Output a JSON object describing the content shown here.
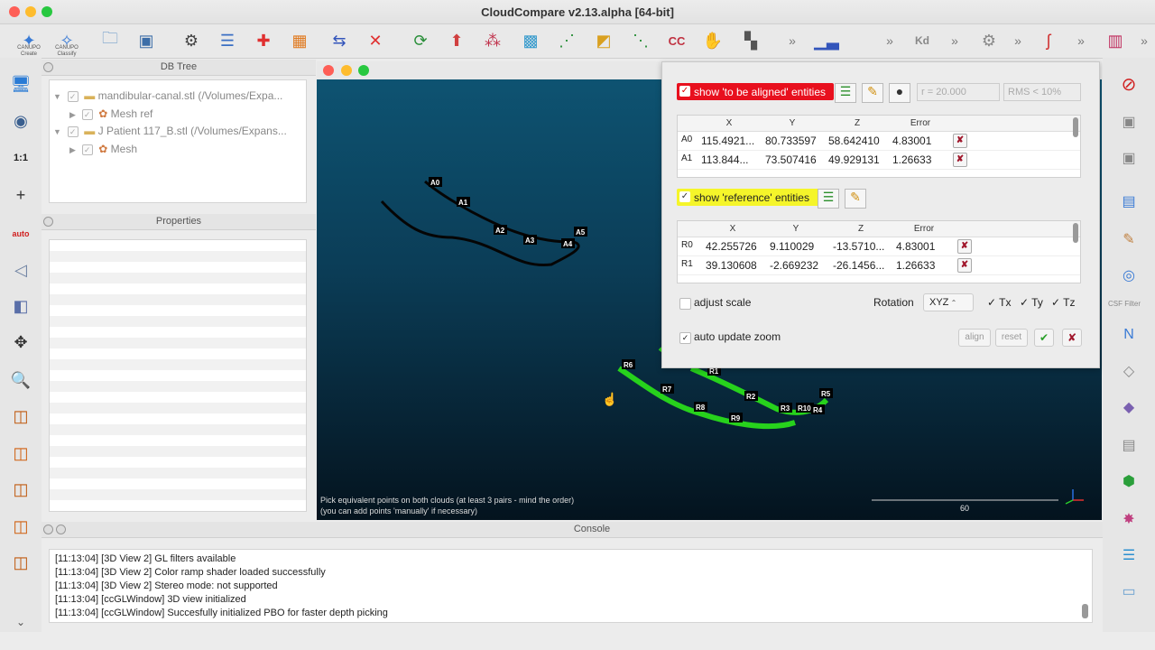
{
  "window": {
    "title": "CloudCompare v2.13.alpha [64-bit]"
  },
  "toolbar": {
    "canupo_create": "CANUPO\nCreate",
    "canupo_classify": "CANUPO\nClassify",
    "kd_label": "Kd"
  },
  "left_tools": {
    "scale_label": "1:1",
    "auto_label": "auto"
  },
  "db_tree": {
    "title": "DB Tree",
    "items": [
      {
        "label": "mandibular-canal.stl (/Volumes/Expa..."
      },
      {
        "label": "Mesh ref"
      },
      {
        "label": "J Patient 117_B.stl (/Volumes/Expans..."
      },
      {
        "label": "Mesh"
      }
    ]
  },
  "properties": {
    "title": "Properties"
  },
  "view": {
    "hint_line1": "Pick equivalent points on both clouds (at least 3 pairs - mind the order)",
    "hint_line2": "(you can add points 'manually' if necessary)",
    "scale_value": "60",
    "points_aligned": [
      "A0",
      "A1",
      "A2",
      "A3",
      "A4",
      "A5"
    ],
    "points_reference": [
      "R1",
      "R2",
      "R3",
      "R10",
      "R4",
      "R5",
      "R6",
      "R7",
      "R8",
      "R9"
    ]
  },
  "dialog": {
    "show_aligned_label": "show 'to be aligned' entities",
    "radius_field": "r = 20.000",
    "rms_field": "RMS < 10%",
    "headers": [
      "X",
      "Y",
      "Z",
      "Error"
    ],
    "aligned_rows": [
      {
        "id": "A0",
        "x": "115.4921...",
        "y": "80.733597",
        "z": "58.642410",
        "err": "4.83001"
      },
      {
        "id": "A1",
        "x": "113.844...",
        "y": "73.507416",
        "z": "49.929131",
        "err": "1.26633"
      }
    ],
    "show_reference_label": "show 'reference' entities",
    "reference_rows": [
      {
        "id": "R0",
        "x": "42.255726",
        "y": "9.110029",
        "z": "-13.5710...",
        "err": "4.83001"
      },
      {
        "id": "R1",
        "x": "39.130608",
        "y": "-2.669232",
        "z": "-26.1456...",
        "err": "1.26633"
      }
    ],
    "adjust_scale_label": "adjust scale",
    "rotation_label": "Rotation",
    "rotation_value": "XYZ",
    "tx": "Tx",
    "ty": "Ty",
    "tz": "Tz",
    "auto_update_zoom_label": "auto update zoom",
    "align_button": "align",
    "reset_button": "reset",
    "colors": {
      "aligned_bg": "#e8101e",
      "reference_bg": "#f5f52a"
    }
  },
  "console": {
    "title": "Console",
    "lines": [
      "[11:13:04] [3D View 2] GL filters available",
      "[11:13:04] [3D View 2] Color ramp shader loaded successfully",
      "[11:13:04] [3D View 2] Stereo mode: not supported",
      "[11:13:04] [ccGLWindow] 3D view initialized",
      "[11:13:04] [ccGLWindow] Succesfully initialized PBO for faster depth picking"
    ]
  },
  "right_tools": {
    "csf_label": "CSF Filter"
  }
}
